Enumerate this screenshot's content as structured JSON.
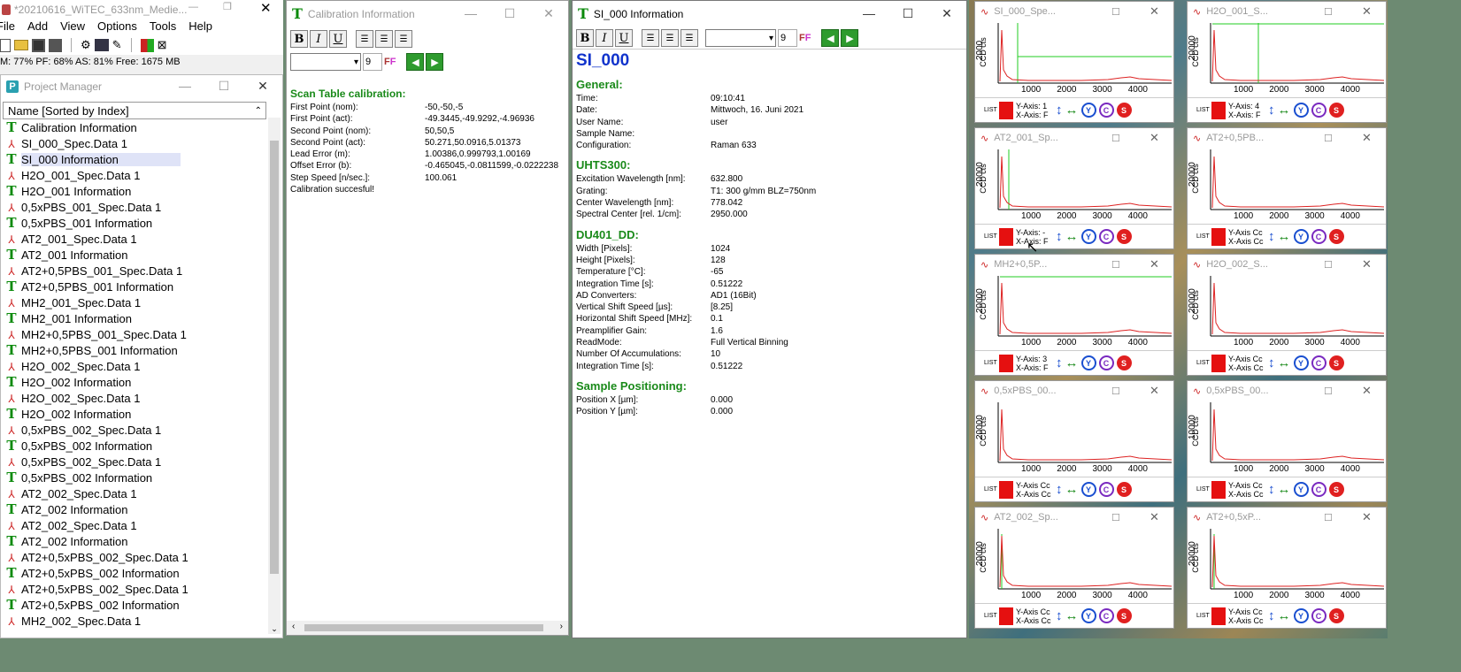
{
  "main_app": {
    "title": "*20210616_WiTEC_633nm_Medie...",
    "menu": [
      "File",
      "Add",
      "View",
      "Options",
      "Tools",
      "Help"
    ],
    "status": "M: 77% PF: 68% AS: 81% Free: 1675 MB"
  },
  "project_manager": {
    "title": "Project Manager",
    "column_header": "Name [Sorted by Index]",
    "items": [
      {
        "label": "Calibration Information",
        "type": "info"
      },
      {
        "label": "SI_000_Spec.Data 1",
        "type": "spec"
      },
      {
        "label": "SI_000 Information",
        "type": "info",
        "selected": true
      },
      {
        "label": "H2O_001_Spec.Data 1",
        "type": "spec"
      },
      {
        "label": "H2O_001 Information",
        "type": "info"
      },
      {
        "label": "0,5xPBS_001_Spec.Data 1",
        "type": "spec"
      },
      {
        "label": "0,5xPBS_001 Information",
        "type": "info"
      },
      {
        "label": "AT2_001_Spec.Data 1",
        "type": "spec"
      },
      {
        "label": "AT2_001 Information",
        "type": "info"
      },
      {
        "label": "AT2+0,5PBS_001_Spec.Data 1",
        "type": "spec"
      },
      {
        "label": "AT2+0,5PBS_001 Information",
        "type": "info"
      },
      {
        "label": "MH2_001_Spec.Data 1",
        "type": "spec"
      },
      {
        "label": "MH2_001 Information",
        "type": "info"
      },
      {
        "label": "MH2+0,5PBS_001_Spec.Data 1",
        "type": "spec"
      },
      {
        "label": "MH2+0,5PBS_001 Information",
        "type": "info"
      },
      {
        "label": "H2O_002_Spec.Data 1",
        "type": "spec"
      },
      {
        "label": "H2O_002 Information",
        "type": "info"
      },
      {
        "label": "H2O_002_Spec.Data 1",
        "type": "spec"
      },
      {
        "label": "H2O_002 Information",
        "type": "info"
      },
      {
        "label": "0,5xPBS_002_Spec.Data 1",
        "type": "spec"
      },
      {
        "label": "0,5xPBS_002 Information",
        "type": "info"
      },
      {
        "label": "0,5xPBS_002_Spec.Data 1",
        "type": "spec"
      },
      {
        "label": "0,5xPBS_002 Information",
        "type": "info"
      },
      {
        "label": "AT2_002_Spec.Data 1",
        "type": "spec"
      },
      {
        "label": "AT2_002 Information",
        "type": "info"
      },
      {
        "label": "AT2_002_Spec.Data 1",
        "type": "spec"
      },
      {
        "label": "AT2_002 Information",
        "type": "info"
      },
      {
        "label": "AT2+0,5xPBS_002_Spec.Data 1",
        "type": "spec"
      },
      {
        "label": "AT2+0,5xPBS_002 Information",
        "type": "info"
      },
      {
        "label": "AT2+0,5xPBS_002_Spec.Data 1",
        "type": "spec"
      },
      {
        "label": "AT2+0,5xPBS_002 Information",
        "type": "info"
      },
      {
        "label": "MH2_002_Spec.Data 1",
        "type": "spec"
      }
    ]
  },
  "calibration": {
    "title": "Calibration Information",
    "font_size": "9",
    "heading": "Scan Table calibration:",
    "rows": [
      {
        "k": "First Point (nom):",
        "v": "-50,-50,-5"
      },
      {
        "k": "First Point (act):",
        "v": "-49.3445,-49.9292,-4.96936"
      },
      {
        "k": "Second Point (nom):",
        "v": "50,50,5"
      },
      {
        "k": "Second Point (act):",
        "v": "50.271,50.0916,5.01373"
      },
      {
        "k": "Lead Error (m):",
        "v": "1.00386,0.999793,1.00169"
      },
      {
        "k": "Offset Error (b):",
        "v": "-0.465045,-0.0811599,-0.0222238"
      },
      {
        "k": "Step Speed [n/sec.]:",
        "v": "100.061"
      }
    ],
    "footer": "Calibration succesful!"
  },
  "si_info": {
    "title": "SI_000 Information",
    "font_size": "9",
    "name": "SI_000",
    "sections": [
      {
        "heading": "General:",
        "rows": [
          {
            "k": "Time:",
            "v": "09:10:41"
          },
          {
            "k": "Date:",
            "v": "Mittwoch, 16. Juni 2021"
          },
          {
            "k": "User Name:",
            "v": "user"
          },
          {
            "k": "Sample Name:",
            "v": ""
          },
          {
            "k": "Configuration:",
            "v": "Raman 633"
          }
        ]
      },
      {
        "heading": "UHTS300:",
        "rows": [
          {
            "k": "Excitation Wavelength [nm]:",
            "v": "632.800"
          },
          {
            "k": "Grating:",
            "v": "T1: 300 g/mm BLZ=750nm"
          },
          {
            "k": "Center Wavelength [nm]:",
            "v": "778.042"
          },
          {
            "k": "Spectral Center [rel. 1/cm]:",
            "v": "2950.000"
          }
        ]
      },
      {
        "heading": "DU401_DD:",
        "rows": [
          {
            "k": "Width [Pixels]:",
            "v": "1024"
          },
          {
            "k": "Height [Pixels]:",
            "v": "128"
          },
          {
            "k": "Temperature [°C]:",
            "v": "-65"
          },
          {
            "k": "Integration Time [s]:",
            "v": "0.51222"
          },
          {
            "k": "AD Converters:",
            "v": "AD1 (16Bit)"
          },
          {
            "k": "Vertical Shift Speed [µs]:",
            "v": "[8.25]"
          },
          {
            "k": "Horizontal Shift Speed [MHz]:",
            "v": "0.1"
          },
          {
            "k": "Preamplifier Gain:",
            "v": "1.6"
          },
          {
            "k": "ReadMode:",
            "v": "Full Vertical Binning"
          },
          {
            "k": "Number Of Accumulations:",
            "v": "10"
          },
          {
            "k": "Integration Time [s]:",
            "v": "0.51222"
          }
        ]
      },
      {
        "heading": "Sample Positioning:",
        "rows": [
          {
            "k": "Position X [µm]:",
            "v": "0.000"
          },
          {
            "k": "Position Y [µm]:",
            "v": "0.000"
          }
        ]
      }
    ]
  },
  "mini_windows": [
    {
      "title": "SI_000_Spe...",
      "ytick": "2000",
      "y": "Y-Axis: 1",
      "x": "X-Axis: F"
    },
    {
      "title": "H2O_001_S...",
      "ytick": "20000",
      "y": "Y-Axis: 4",
      "x": "X-Axis: F"
    },
    {
      "title": "AT2_001_Sp...",
      "ytick": "20000",
      "y": "Y-Axis: -",
      "x": "X-Axis: F"
    },
    {
      "title": "AT2+0,5PB...",
      "ytick": "20000",
      "y": "Y-Axis Cc",
      "x": "X-Axis Cc"
    },
    {
      "title": "MH2+0,5P...",
      "ytick": "20000",
      "y": "Y-Axis: 3",
      "x": "X-Axis: F"
    },
    {
      "title": "H2O_002_S...",
      "ytick": "20000",
      "y": "Y-Axis Cc",
      "x": "X-Axis Cc"
    },
    {
      "title": "0,5xPBS_00...",
      "ytick": "20000",
      "y": "Y-Axis Cc",
      "x": "X-Axis Cc"
    },
    {
      "title": "0,5xPBS_00...",
      "ytick": "10000",
      "y": "Y-Axis Cc",
      "x": "X-Axis Cc"
    },
    {
      "title": "AT2_002_Sp...",
      "ytick": "20000",
      "y": "Y-Axis Cc",
      "x": "X-Axis Cc"
    },
    {
      "title": "AT2+0,5xP...",
      "ytick": "20000",
      "y": "Y-Axis Cc",
      "x": "X-Axis Cc"
    }
  ],
  "mini_common": {
    "ylabel": "CCD cts",
    "xticks": [
      "1000",
      "2000",
      "3000",
      "4000"
    ],
    "list_label": "LIST"
  }
}
